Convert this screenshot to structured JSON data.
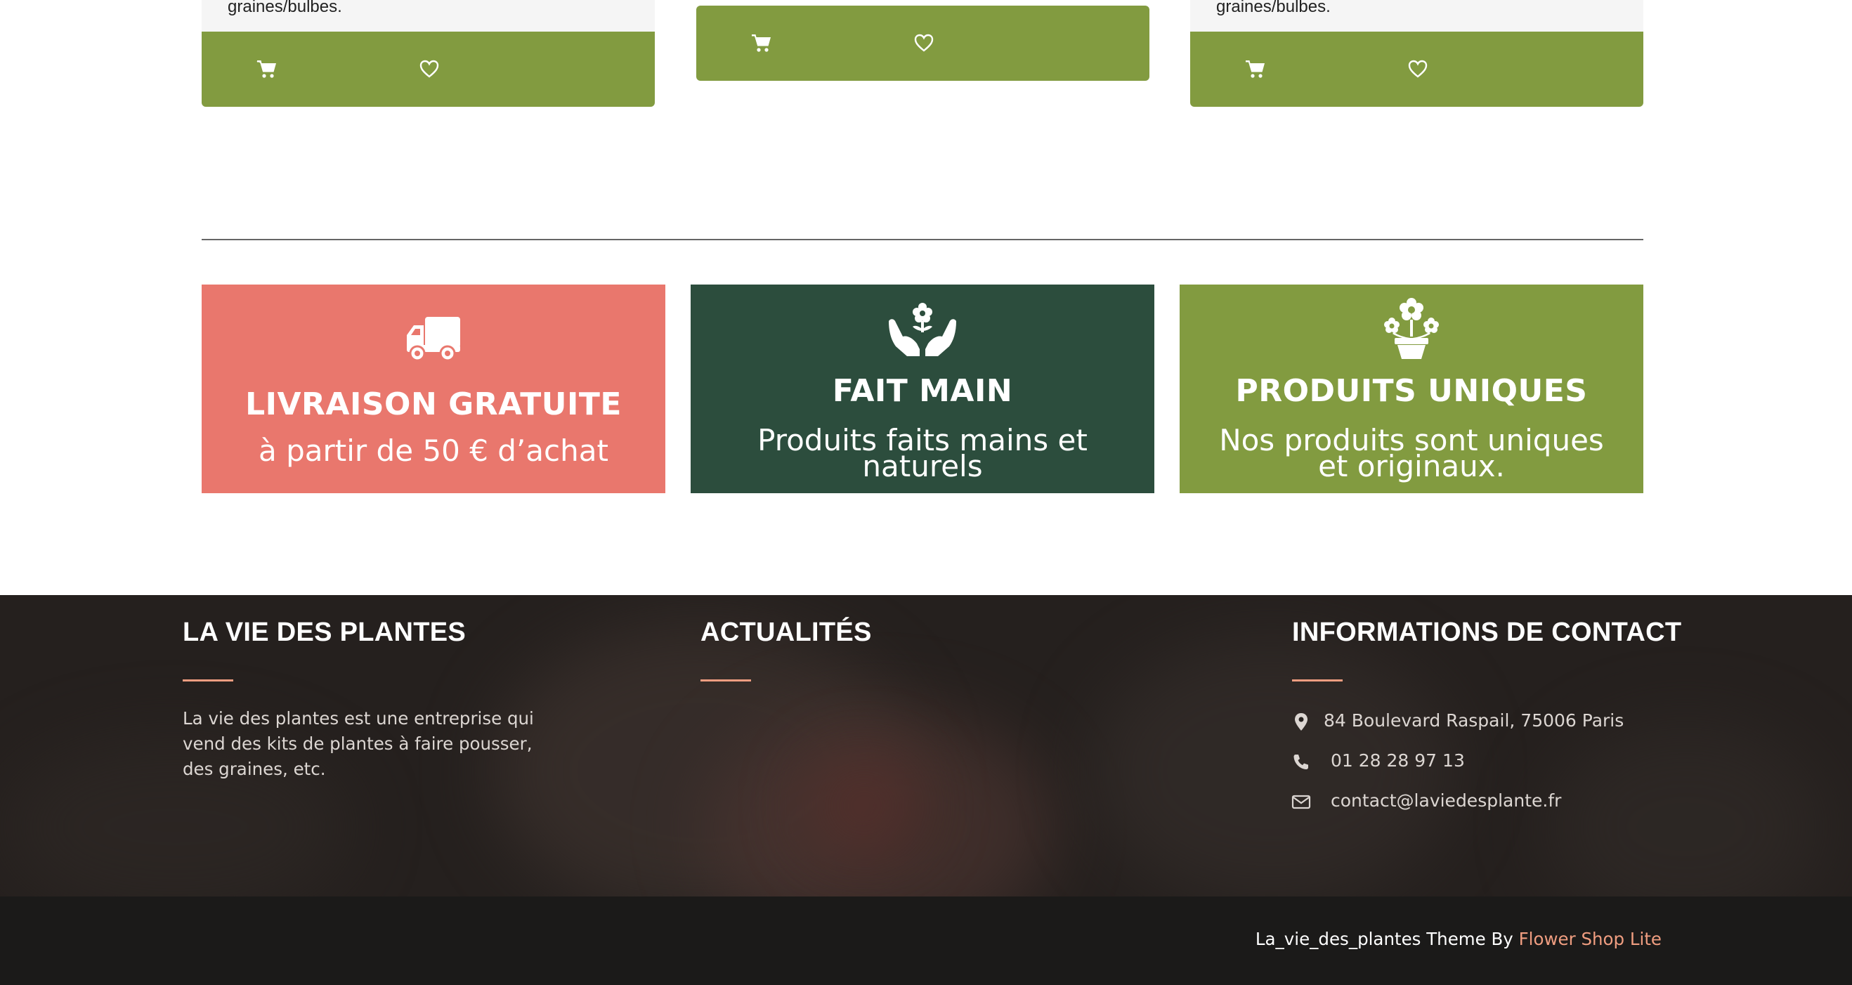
{
  "products": [
    {
      "description": "graines/bulbes.",
      "cart_icon": "cart-icon",
      "wishlist_icon": "heart-icon"
    },
    {
      "description": "",
      "cart_icon": "cart-icon",
      "wishlist_icon": "heart-icon"
    },
    {
      "description": "graines/bulbes.",
      "cart_icon": "cart-icon",
      "wishlist_icon": "heart-icon"
    }
  ],
  "features": [
    {
      "icon": "truck-icon",
      "title": "LIVRAISON GRATUITE",
      "text": "à partir de 50 € d’achat",
      "color": "#e9776d"
    },
    {
      "icon": "hands-flower-icon",
      "title": "FAIT MAIN",
      "text": "Produits faits mains et naturels",
      "color": "#2c4d3d"
    },
    {
      "icon": "potted-flower-icon",
      "title": "PRODUITS UNIQUES",
      "text": "Nos produits sont uniques et originaux.",
      "color": "#829b40"
    }
  ],
  "footer": {
    "about": {
      "heading": "LA VIE DES PLANTES",
      "text": "La vie des plantes est une entreprise qui vend des kits de plantes à faire pousser, des graines, etc."
    },
    "news": {
      "heading": "ACTUALITÉS"
    },
    "contact": {
      "heading": "INFORMATIONS DE CONTACT",
      "address": "84 Boulevard Raspail, 75006 Paris",
      "phone": "01 28 28 97 13",
      "email": "contact@laviedesplante.fr"
    },
    "credit_prefix": "La_vie_des_plantes Theme By ",
    "credit_link": "Flower Shop Lite"
  },
  "colors": {
    "accent_green": "#829b40",
    "accent_salmon": "#ef9d80",
    "footer_bg": "#25201e",
    "bottom_bar_bg": "#1b1a19"
  }
}
